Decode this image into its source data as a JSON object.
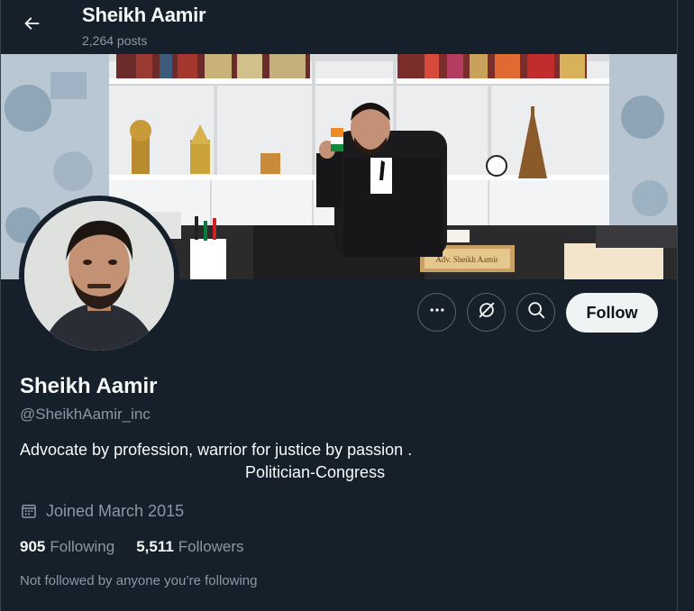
{
  "header": {
    "name": "Sheikh Aamir",
    "posts_count": "2,264 posts"
  },
  "banner": {
    "nameplate_text": "Adv. Sheikh Aamir"
  },
  "actions": {
    "more_icon": "more-icon",
    "grok_icon": "grok-icon",
    "search_icon": "search-icon",
    "follow_label": "Follow"
  },
  "profile": {
    "display_name": "Sheikh Aamir",
    "handle": "@SheikhAamir_inc",
    "bio_line1": "Advocate by profession, warrior for justice by passion .",
    "bio_line2": "Politician-Congress",
    "joined": "Joined March 2015",
    "following_count": "905",
    "following_label": "Following",
    "followers_count": "5,511",
    "followers_label": "Followers",
    "not_followed_text": "Not followed by anyone you’re following"
  },
  "colors": {
    "background": "#15202b",
    "text_primary": "#f7f9f9",
    "text_secondary": "#8b98a5",
    "follow_button_bg": "#eff3f4",
    "border": "#38444d"
  }
}
